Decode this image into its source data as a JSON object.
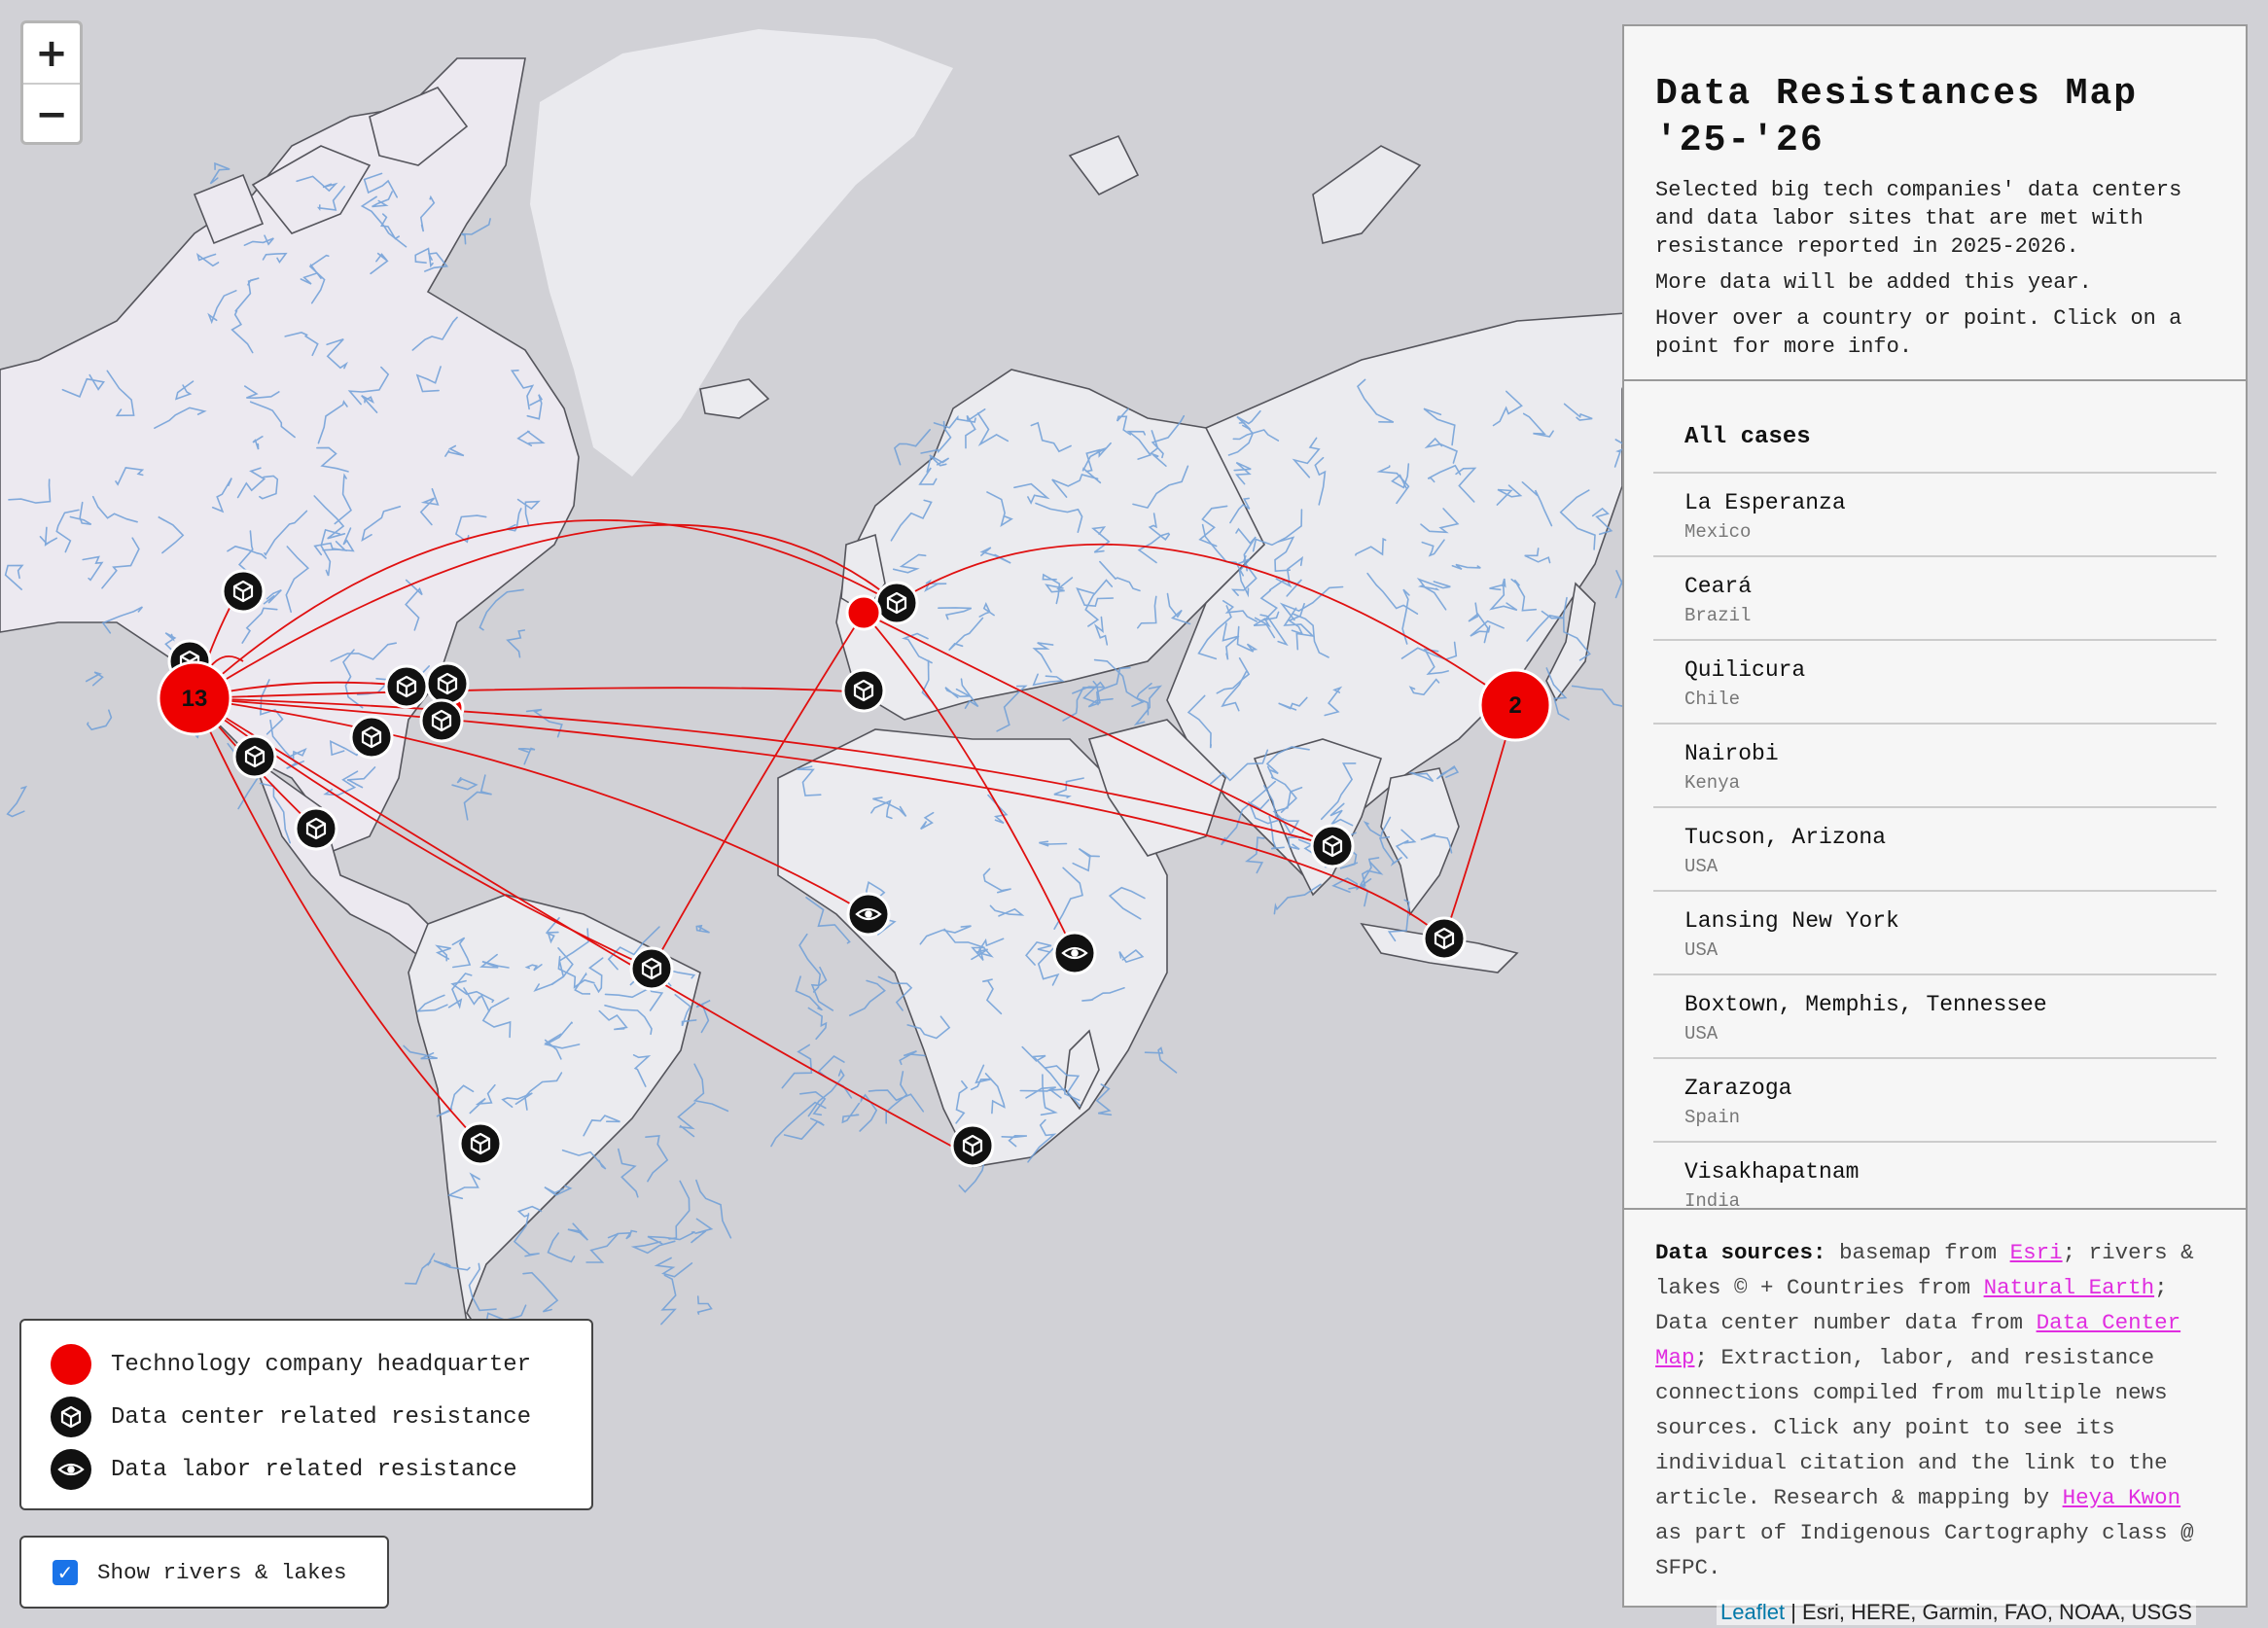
{
  "zoom": {
    "in_label": "+",
    "out_label": "−"
  },
  "panel": {
    "title": "Data Resistances Map '25-'26",
    "desc1": "Selected big tech companies' data centers and data labor sites that are met with resistance reported in 2025-2026.",
    "desc2": "More data will be added this year.",
    "desc3": "Hover over a country or point. Click on a point for more info.",
    "list_header": "All cases",
    "cases": [
      {
        "name": "La Esperanza",
        "country": "Mexico"
      },
      {
        "name": "Ceará",
        "country": "Brazil"
      },
      {
        "name": "Quilicura",
        "country": "Chile"
      },
      {
        "name": "Nairobi",
        "country": "Kenya"
      },
      {
        "name": "Tucson, Arizona",
        "country": "USA"
      },
      {
        "name": "Lansing New York",
        "country": "USA"
      },
      {
        "name": "Boxtown, Memphis, Tennessee",
        "country": "USA"
      },
      {
        "name": "Zarazoga",
        "country": "Spain"
      },
      {
        "name": "Visakhapatnam",
        "country": "India"
      }
    ],
    "sources": {
      "label": "Data sources:",
      "t1": "basemap from",
      "l1": "Esri",
      "t2": "; rivers & lakes © + Countries from",
      "l2": "Natural Earth",
      "t3": "; Data center number data from",
      "l3": "Data Center Map",
      "t4": "; Extraction, labor, and resistance connections compiled from multiple news sources. Click any point to see its individual citation and the link to the article. Research & mapping by",
      "l4": "Heya Kwon",
      "t5": "as part of Indigenous Cartography class @ SFPC."
    }
  },
  "legend": {
    "hq": "Technology company headquarter",
    "dc": "Data center related resistance",
    "dl": "Data labor related resistance"
  },
  "toggle": {
    "label": "Show rivers & lakes",
    "checked": true
  },
  "attribution": {
    "leaflet": "Leaflet",
    "rest": "| Esri, HERE, Garmin, FAO, NOAA, USGS"
  },
  "clusters": {
    "usa_hq": "13",
    "china_hq": "2"
  },
  "colors": {
    "water": "#d1d1d6",
    "land": "#ebebef",
    "land_na": "#ece9f0",
    "river": "#6f9fd8",
    "route": "#e01010",
    "hq": "#ee0000",
    "marker": "#111111"
  },
  "icons": {
    "dc": "cube-icon",
    "dl": "eye-icon"
  }
}
